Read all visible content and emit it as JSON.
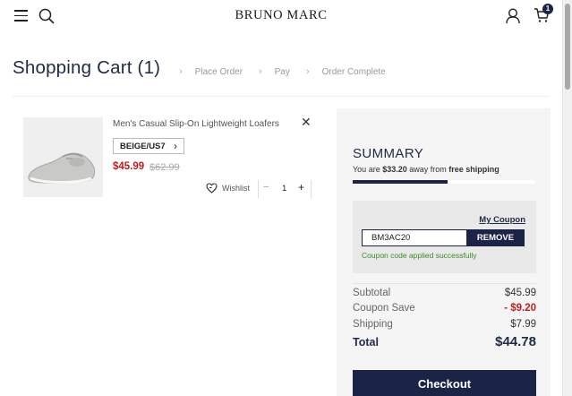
{
  "header": {
    "logo": "BRUNO MARC",
    "cart_count": "1",
    "icons": [
      "menu-icon",
      "search-icon",
      "user-icon",
      "cart-icon"
    ]
  },
  "page": {
    "title": "Shopping Cart (1)",
    "steps": [
      "Place Order",
      "Pay",
      "Order Complete"
    ]
  },
  "item": {
    "name": "Men's Casual Slip-On Lightweight Loafers",
    "variant": "BEIGE/US7",
    "price": "$45.99",
    "original_price": "$62.99",
    "wishlist_label": "Wishlist",
    "quantity": "1"
  },
  "summary": {
    "title": "SUMMARY",
    "ship_prefix": "You are ",
    "ship_amount": "$33.20",
    "ship_middle": " away from ",
    "ship_target": "free shipping",
    "progress_fraction": 0.52,
    "my_coupon": "My Coupon",
    "coupon_code": "BM3AC20",
    "remove_label": "REMOVE",
    "coupon_message": "Coupon code applied successfully",
    "rows": {
      "subtotal_label": "Subtotal",
      "subtotal_value": "$45.99",
      "coupon_label": "Coupon Save",
      "coupon_value": "- $9.20",
      "shipping_label": "Shipping",
      "shipping_value": "$7.99",
      "total_label": "Total",
      "total_value": "$44.78"
    },
    "checkout_label": "Checkout"
  },
  "colors": {
    "navy": "#1b2446",
    "sale_red": "#c21b1b",
    "success_green": "#3a8a2a"
  }
}
